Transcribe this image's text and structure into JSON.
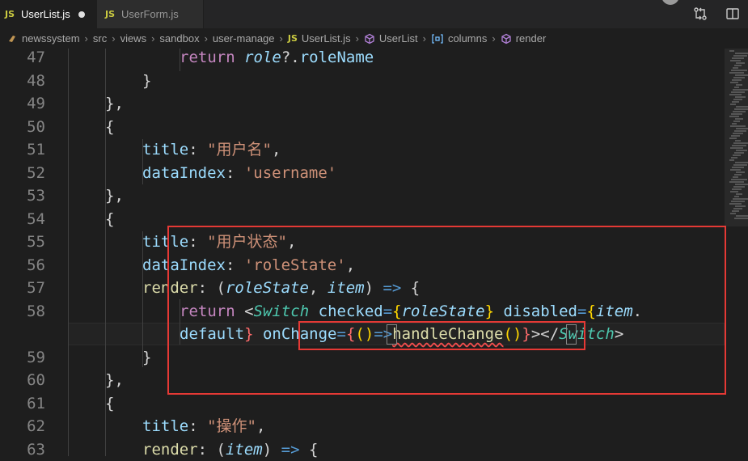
{
  "tabs": [
    {
      "label": "UserList.js",
      "badge": "JS",
      "active": true,
      "modified": true
    },
    {
      "label": "UserForm.js",
      "badge": "JS",
      "active": false,
      "modified": false
    }
  ],
  "breadcrumb": {
    "items": [
      "newssystem",
      "src",
      "views",
      "sandbox",
      "user-manage"
    ],
    "file_badge": "JS",
    "file": "UserList.js",
    "symbols": [
      "UserList",
      "columns",
      "render"
    ]
  },
  "lines": [
    {
      "n": "47",
      "tokens": [
        [
          "kw",
          "return "
        ],
        [
          "pi",
          "role"
        ],
        [
          "pn",
          "?."
        ],
        [
          "pr",
          "roleName"
        ]
      ]
    },
    {
      "n": "48",
      "tokens": [
        [
          "pn",
          "}"
        ]
      ]
    },
    {
      "n": "49",
      "tokens": [
        [
          "pn",
          "},"
        ]
      ]
    },
    {
      "n": "50",
      "tokens": [
        [
          "pn",
          "{"
        ]
      ]
    },
    {
      "n": "51",
      "tokens": [
        [
          "pr",
          "title"
        ],
        [
          "pn",
          ": "
        ],
        [
          "st",
          "\"用户名\""
        ],
        [
          "pn",
          ","
        ]
      ]
    },
    {
      "n": "52",
      "tokens": [
        [
          "pr",
          "dataIndex"
        ],
        [
          "pn",
          ": "
        ],
        [
          "st",
          "'username'"
        ]
      ]
    },
    {
      "n": "53",
      "tokens": [
        [
          "pn",
          "},"
        ]
      ]
    },
    {
      "n": "54",
      "tokens": [
        [
          "pn",
          "{"
        ]
      ]
    },
    {
      "n": "55",
      "tokens": [
        [
          "pr",
          "title"
        ],
        [
          "pn",
          ": "
        ],
        [
          "st",
          "\"用户状态\""
        ],
        [
          "pn",
          ","
        ]
      ]
    },
    {
      "n": "56",
      "tokens": [
        [
          "pr",
          "dataIndex"
        ],
        [
          "pn",
          ": "
        ],
        [
          "st",
          "'roleState'"
        ],
        [
          "pn",
          ","
        ]
      ]
    },
    {
      "n": "57",
      "tokens": [
        [
          "fn",
          "render"
        ],
        [
          "pn",
          ": ("
        ],
        [
          "pi",
          "roleState"
        ],
        [
          "pn",
          ", "
        ],
        [
          "pi",
          "item"
        ],
        [
          "pn",
          ") "
        ],
        [
          "op",
          "=>"
        ],
        [
          "pn",
          " {"
        ]
      ]
    },
    {
      "n": "58",
      "tokens": [
        [
          "kw",
          "return "
        ],
        [
          "pn",
          "<"
        ],
        [
          "tg",
          "Switch"
        ],
        [
          "pn",
          " "
        ],
        [
          "pr",
          "checked"
        ],
        [
          "op",
          "="
        ],
        [
          "br",
          "{"
        ],
        [
          "pi",
          "roleState"
        ],
        [
          "br",
          "}"
        ],
        [
          "pn",
          " "
        ],
        [
          "pr",
          "disabled"
        ],
        [
          "op",
          "="
        ],
        [
          "br",
          "{"
        ],
        [
          "pi",
          "item"
        ],
        [
          "pn",
          "."
        ]
      ]
    },
    {
      "n": "",
      "tokens": [
        [
          "pr",
          "default"
        ],
        [
          "rd",
          "}"
        ],
        [
          "pn",
          " "
        ],
        [
          "pr",
          "onChange"
        ],
        [
          "op",
          "="
        ],
        [
          "rd",
          "{"
        ],
        [
          "br",
          "("
        ],
        [
          "br",
          ")"
        ],
        [
          "op",
          "=>"
        ],
        [
          "fn",
          "handleChange"
        ],
        [
          "br",
          "("
        ],
        [
          "br",
          ")"
        ],
        [
          "rd",
          "}"
        ],
        [
          "pn",
          "></"
        ],
        [
          "tg",
          "Switch"
        ],
        [
          "pn",
          ">"
        ]
      ]
    },
    {
      "n": "59",
      "tokens": [
        [
          "pn",
          "}"
        ]
      ]
    },
    {
      "n": "60",
      "tokens": [
        [
          "pn",
          "},"
        ]
      ]
    },
    {
      "n": "61",
      "tokens": [
        [
          "pn",
          "{"
        ]
      ]
    },
    {
      "n": "62",
      "tokens": [
        [
          "pr",
          "title"
        ],
        [
          "pn",
          ": "
        ],
        [
          "st",
          "\"操作\""
        ],
        [
          "pn",
          ","
        ]
      ]
    },
    {
      "n": "63",
      "tokens": [
        [
          "fn",
          "render"
        ],
        [
          "pn",
          ": ("
        ],
        [
          "pi",
          "item"
        ],
        [
          "pn",
          ") "
        ],
        [
          "op",
          "=>"
        ],
        [
          "pn",
          " {"
        ]
      ]
    }
  ],
  "colors": {
    "keyword": "#c586c0",
    "function": "#dcdcaa",
    "property": "#9cdcfe",
    "string": "#ce9178",
    "operator": "#569cd6",
    "tag": "#4ec9b0",
    "bracket": "#ffd700",
    "highlight_box": "#e53935"
  },
  "icons": {
    "tab_actions": [
      "git-compare-icon",
      "split-editor-icon"
    ],
    "breadcrumb_folder": "folder-icon",
    "breadcrumb_symbol": "symbol-class-icon",
    "breadcrumb_field": "symbol-field-icon"
  }
}
